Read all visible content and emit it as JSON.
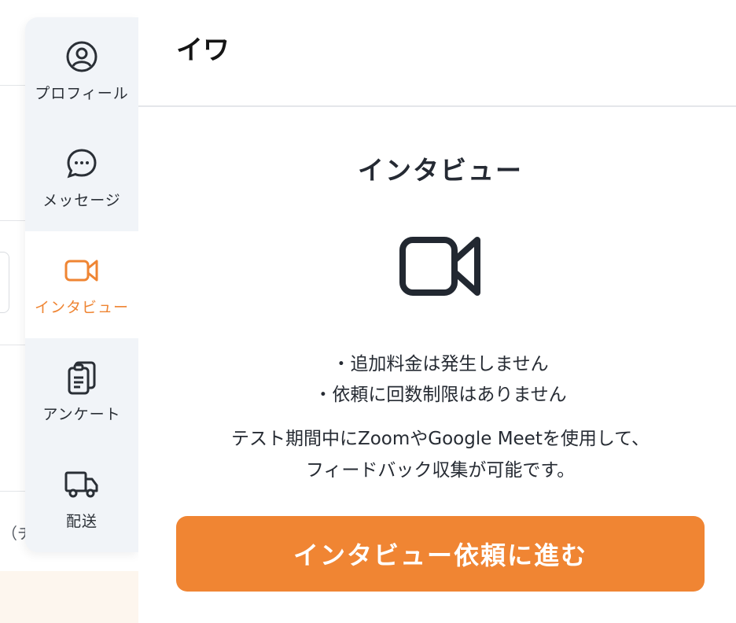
{
  "background": {
    "partial_text": "（チ"
  },
  "sidebar": {
    "items": [
      {
        "label": "プロフィール",
        "icon": "user-circle-icon",
        "active": false
      },
      {
        "label": "メッセージ",
        "icon": "chat-bubble-icon",
        "active": false
      },
      {
        "label": "インタビュー",
        "icon": "video-camera-icon",
        "active": true
      },
      {
        "label": "アンケート",
        "icon": "clipboard-icon",
        "active": false
      },
      {
        "label": "配送",
        "icon": "truck-icon",
        "active": false
      }
    ],
    "active_color": "#ef8533"
  },
  "panel": {
    "title": "イワ",
    "section_title": "インタビュー",
    "icon": "video-camera-icon",
    "bullets": [
      "・追加料金は発生しません",
      "・依頼に回数制限はありません"
    ],
    "description_lines": [
      "テスト期間中にZoomやGoogle Meetを使用して、",
      "フィードバック収集が可能です。"
    ],
    "cta_label": "インタビュー依頼に進む",
    "cta_color": "#f08533"
  }
}
